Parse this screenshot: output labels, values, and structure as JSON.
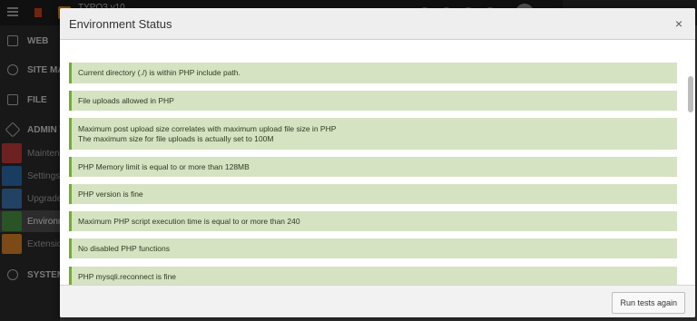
{
  "app": {
    "site_name": "TYPO3 v10",
    "colors": {
      "topbar": "#1e1e1e",
      "sidebar": "#2d2d2d",
      "brand": "#f49700"
    }
  },
  "sidebar": {
    "groups": [
      {
        "label": "WEB",
        "icon": "file-icon"
      },
      {
        "label": "SITE MA",
        "icon": "globe-icon"
      },
      {
        "label": "FILE",
        "icon": "image-icon"
      },
      {
        "label": "ADMIN T",
        "icon": "rocket-icon"
      },
      {
        "label": "SYSTEM",
        "icon": "gear-icon"
      }
    ],
    "admin_items": [
      {
        "label": "Maintena",
        "icon": "wrench-icon",
        "color": "#c83c3c"
      },
      {
        "label": "Settings",
        "icon": "cogs-icon",
        "color": "#2f6fb0"
      },
      {
        "label": "Upgrade",
        "icon": "upgrade-icon",
        "color": "#3d78b5"
      },
      {
        "label": "Environm",
        "icon": "environment-icon",
        "color": "#4f9a45"
      },
      {
        "label": "Extension",
        "icon": "extension-icon",
        "color": "#e0872a"
      }
    ]
  },
  "modal": {
    "title": "Environment Status",
    "close_label": "×",
    "messages": [
      {
        "text": "Current directory (./) is within PHP include path."
      },
      {
        "text": "File uploads allowed in PHP"
      },
      {
        "text": "Maximum post upload size correlates with maximum upload file size in PHP",
        "detail": "The maximum size for file uploads is actually set to 100M"
      },
      {
        "text": "PHP Memory limit is equal to or more than 128MB"
      },
      {
        "text": "PHP version is fine"
      },
      {
        "text": "Maximum PHP script execution time is equal to or more than 240"
      },
      {
        "text": "No disabled PHP functions"
      },
      {
        "text": "PHP mysqli.reconnect is fine"
      }
    ],
    "run_button_label": "Run tests again",
    "colors": {
      "ok_bg": "#d6e3c2",
      "ok_border": "#79a548"
    }
  }
}
